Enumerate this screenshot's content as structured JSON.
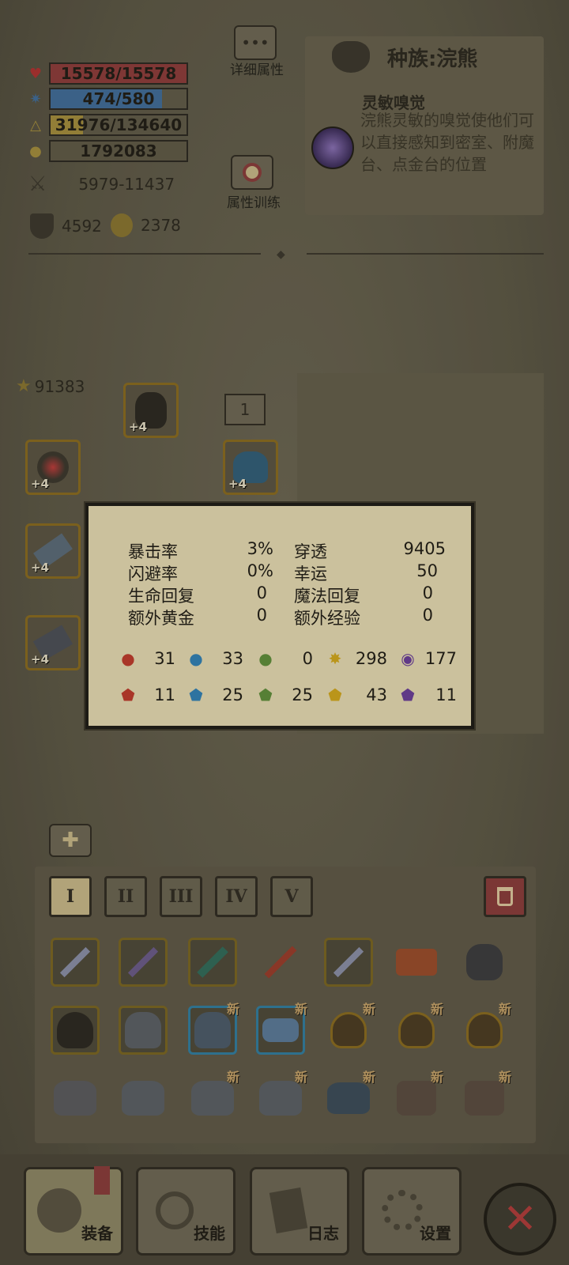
{
  "colors": {
    "hp_bar": "#8e3a3a",
    "mana_bar": "#3f6c9a",
    "exp_bar": "#a58d3c",
    "tooltip_bg": "#e8dcb4",
    "gold_border": "#8a6a1e",
    "blue_border": "#2f7da2",
    "close_x": "#b23a3a"
  },
  "stats": {
    "hp": {
      "text": "15578/15578",
      "fill": 1.0,
      "icon": "heart-icon"
    },
    "mana": {
      "text": "474/580",
      "fill": 0.817,
      "icon": "mana-icon"
    },
    "exp": {
      "text": "31976/134640",
      "fill": 0.237,
      "icon": "exp-triangle-icon"
    },
    "gold": {
      "text": "1792083",
      "icon": "gold-coins-icon"
    },
    "attack": {
      "text": "5979-11437",
      "icon": "crossed-swords-icon"
    },
    "defense": {
      "text": "4592",
      "icon": "shield-icon"
    },
    "magic_resist": {
      "text": "2378",
      "icon": "magic-resist-icon"
    }
  },
  "buttons": {
    "detail_attr": "详细属性",
    "attr_training": "属性训练"
  },
  "race": {
    "title": "种族:浣熊",
    "skill_name": "灵敏嗅觉",
    "skill_desc": "浣熊灵敏的嗅觉使他们可以直接感知到密室、附魔台、点金台的位置"
  },
  "power_score": "91383",
  "slot_count": "1",
  "equipped": [
    {
      "name": "helmet-dark",
      "plus": "+4"
    },
    {
      "name": "amulet-eye",
      "plus": "+4"
    },
    {
      "name": "helmet-blue",
      "plus": "+4"
    },
    {
      "name": "hammer",
      "plus": "+4"
    },
    {
      "name": "gauntlet",
      "plus": "+4"
    }
  ],
  "tooltip": {
    "rows": [
      {
        "l1": "暴击率",
        "v1": "3%",
        "l2": "穿透",
        "v2": "9405"
      },
      {
        "l1": "闪避率",
        "v1": "0%",
        "l2": "幸运",
        "v2": "50"
      },
      {
        "l1": "生命回复",
        "v1": "0",
        "l2": "魔法回复",
        "v2": "0"
      },
      {
        "l1": "额外黄金",
        "v1": "0",
        "l2": "额外经验",
        "v2": "0"
      }
    ],
    "attack_elements": [
      {
        "icon": "fire-drop-icon",
        "color": "#c0392b",
        "value": "31"
      },
      {
        "icon": "water-drop-icon",
        "color": "#2f80b8",
        "value": "33"
      },
      {
        "icon": "leaf-icon",
        "color": "#5f8f3a",
        "value": "0"
      },
      {
        "icon": "lightning-icon",
        "color": "#d4a81a",
        "value": "298"
      },
      {
        "icon": "shadow-orb-icon",
        "color": "#6a3d9a",
        "value": "177"
      }
    ],
    "resist_elements": [
      {
        "icon": "fire-resist-icon",
        "color": "#c0392b",
        "value": "11"
      },
      {
        "icon": "water-resist-icon",
        "color": "#2f80b8",
        "value": "25"
      },
      {
        "icon": "leaf-resist-icon",
        "color": "#5f8f3a",
        "value": "25"
      },
      {
        "icon": "lightning-resist-icon",
        "color": "#d4a81a",
        "value": "43"
      },
      {
        "icon": "shadow-resist-icon",
        "color": "#6a3d9a",
        "value": "11"
      }
    ]
  },
  "inventory_tabs": [
    "I",
    "II",
    "III",
    "IV",
    "V"
  ],
  "new_tag": "新",
  "inventory": [
    [
      {
        "type": "sword",
        "border": "gold"
      },
      {
        "type": "dagger",
        "border": "gold"
      },
      {
        "type": "scythe",
        "border": "gold"
      },
      {
        "type": "sword-locked",
        "border": "none"
      },
      {
        "type": "sword",
        "border": "gold"
      },
      {
        "type": "crown-locked",
        "border": "none"
      },
      {
        "type": "horned-helm",
        "border": "none"
      }
    ],
    [
      {
        "type": "hood",
        "border": "gold"
      },
      {
        "type": "helm",
        "border": "gold"
      },
      {
        "type": "helm",
        "border": "blue",
        "new": true
      },
      {
        "type": "tiara",
        "border": "blue",
        "new": true
      },
      {
        "type": "hood-gold",
        "border": "none",
        "new": true
      },
      {
        "type": "hood-gold",
        "border": "none",
        "new": true
      },
      {
        "type": "hood-gold",
        "border": "none",
        "new": true
      }
    ],
    [
      {
        "type": "armor",
        "border": "none"
      },
      {
        "type": "armor",
        "border": "none"
      },
      {
        "type": "armor",
        "border": "none",
        "new": true
      },
      {
        "type": "armor",
        "border": "none",
        "new": true
      },
      {
        "type": "armor-blue",
        "border": "none",
        "new": true
      },
      {
        "type": "armor-red",
        "border": "none",
        "new": true
      },
      {
        "type": "armor-red",
        "border": "none",
        "new": true
      }
    ]
  ],
  "nav": [
    {
      "label": "装备",
      "icon": "equipment-icon"
    },
    {
      "label": "技能",
      "icon": "skill-icon"
    },
    {
      "label": "日志",
      "icon": "journal-icon"
    },
    {
      "label": "设置",
      "icon": "gear-icon"
    }
  ]
}
